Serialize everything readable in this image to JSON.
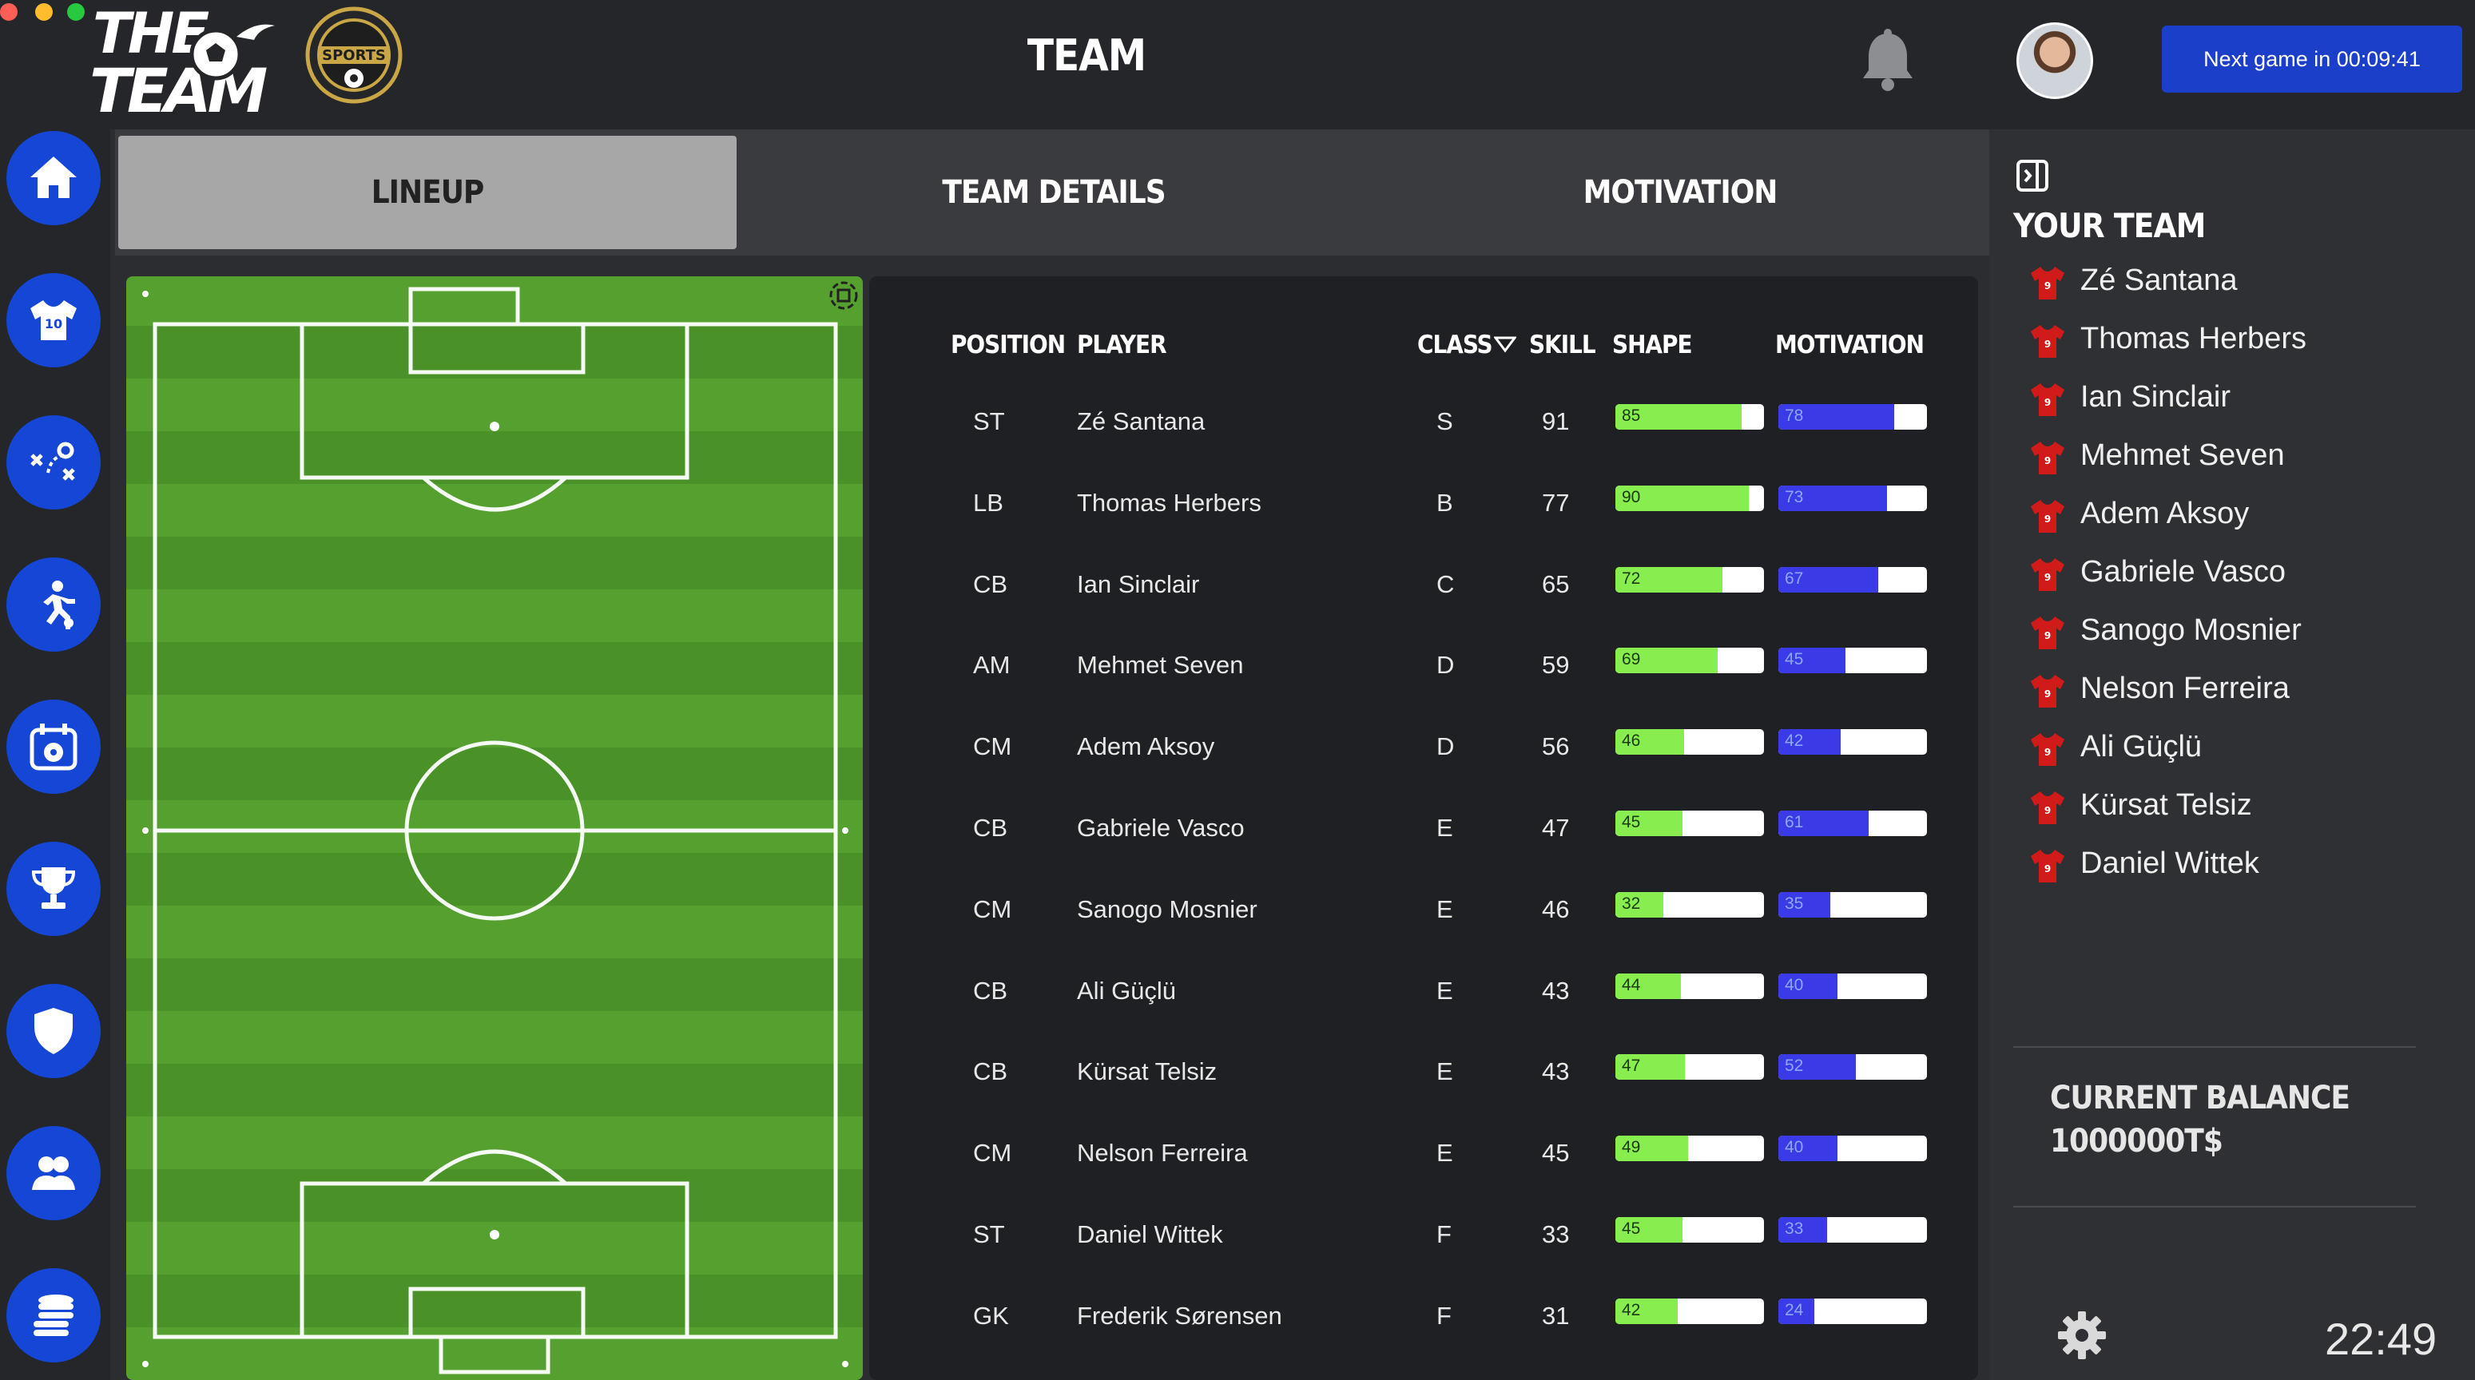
{
  "app": {
    "logo_text": "THE TEAM",
    "badge_text": "SPORTS",
    "title": "TEAM",
    "next_game": "Next game in 00:09:41",
    "clock": "22:49"
  },
  "colors": {
    "accent": "#1546d6",
    "shape_bar": "#88ee50",
    "motivation_bar": "#3a3ae6",
    "topbar": "#252629"
  },
  "sidebar": {
    "items": [
      {
        "icon": "home-icon"
      },
      {
        "icon": "jersey-icon"
      },
      {
        "icon": "tactics-icon"
      },
      {
        "icon": "training-icon"
      },
      {
        "icon": "calendar-icon"
      },
      {
        "icon": "trophy-icon"
      },
      {
        "icon": "shield-icon"
      },
      {
        "icon": "users-icon"
      },
      {
        "icon": "coins-icon"
      }
    ]
  },
  "tabs": [
    {
      "label": "LINEUP",
      "active": true
    },
    {
      "label": "TEAM DETAILS"
    },
    {
      "label": "MOTIVATION"
    }
  ],
  "table": {
    "headers": {
      "position": "POSITION",
      "player": "PLAYER",
      "class": "CLASS",
      "skill": "SKILL",
      "shape": "SHAPE",
      "motivation": "MOTIVATION"
    },
    "rows": [
      {
        "position": "ST",
        "player": "Zé Santana",
        "class": "S",
        "skill": "91",
        "shape": 85,
        "motivation": 78
      },
      {
        "position": "LB",
        "player": "Thomas Herbers",
        "class": "B",
        "skill": "77",
        "shape": 90,
        "motivation": 73
      },
      {
        "position": "CB",
        "player": "Ian Sinclair",
        "class": "C",
        "skill": "65",
        "shape": 72,
        "motivation": 67
      },
      {
        "position": "AM",
        "player": "Mehmet Seven",
        "class": "D",
        "skill": "59",
        "shape": 69,
        "motivation": 45
      },
      {
        "position": "CM",
        "player": "Adem Aksoy",
        "class": "D",
        "skill": "56",
        "shape": 46,
        "motivation": 42
      },
      {
        "position": "CB",
        "player": "Gabriele Vasco",
        "class": "E",
        "skill": "47",
        "shape": 45,
        "motivation": 61
      },
      {
        "position": "CM",
        "player": "Sanogo Mosnier",
        "class": "E",
        "skill": "46",
        "shape": 32,
        "motivation": 35
      },
      {
        "position": "CB",
        "player": "Ali Güçlü",
        "class": "E",
        "skill": "43",
        "shape": 44,
        "motivation": 40
      },
      {
        "position": "CB",
        "player": "Kürsat Telsiz",
        "class": "E",
        "skill": "43",
        "shape": 47,
        "motivation": 52
      },
      {
        "position": "CM",
        "player": "Nelson Ferreira",
        "class": "E",
        "skill": "45",
        "shape": 49,
        "motivation": 40
      },
      {
        "position": "ST",
        "player": "Daniel Wittek",
        "class": "F",
        "skill": "33",
        "shape": 45,
        "motivation": 33
      },
      {
        "position": "GK",
        "player": "Frederik Sørensen",
        "class": "F",
        "skill": "31",
        "shape": 42,
        "motivation": 24
      }
    ]
  },
  "your_team": {
    "title": "YOUR TEAM",
    "players": [
      "Zé Santana",
      "Thomas Herbers",
      "Ian Sinclair",
      "Mehmet Seven",
      "Adem Aksoy",
      "Gabriele Vasco",
      "Sanogo Mosnier",
      "Nelson Ferreira",
      "Ali Güçlü",
      "Kürsat Telsiz",
      "Daniel Wittek"
    ],
    "jersey_number": "9"
  },
  "balance": {
    "label": "CURRENT BALANCE",
    "value": "1000000T$"
  }
}
